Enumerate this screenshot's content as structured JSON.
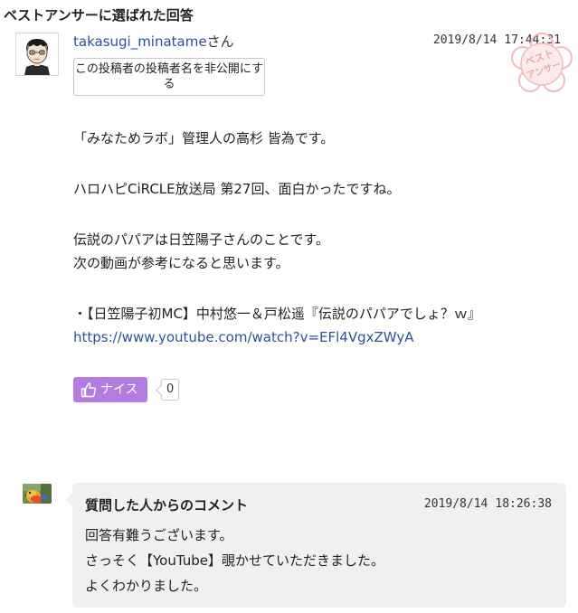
{
  "section_title": "ベストアンサーに選ばれた回答",
  "answer": {
    "author_name": "takasugi_minatame",
    "author_suffix": "さん",
    "date": "2019/8/14",
    "time": "17:44:31",
    "hide_name_button": "この投稿者の投稿者名を非公開にする",
    "best_answer_stamp": "ベスト アンサー",
    "body": {
      "line1": "「みなためラボ」管理人の高杉 皆為です。",
      "line2": "ハロハピCiRCLE放送局 第27回、面白かったですね。",
      "line3": "伝説のパパアは日笠陽子さんのことです。",
      "line4": "次の動画が参考になると思います。",
      "line5": "・【日笠陽子初MC】中村悠一＆戸松遥『伝説のパパアでしょ？ｗ』",
      "link": "https://www.youtube.com/watch?v=EFl4VgxZWyA"
    },
    "nice_label": "ナイス",
    "nice_count": "0"
  },
  "comment": {
    "title": "質問した人からのコメント",
    "date": "2019/8/14",
    "time": "18:26:38",
    "line1": "回答有難うございます。",
    "line2": "さっそく【YouTube】覗かせていただきました。",
    "line3": "よくわかりました。"
  },
  "colors": {
    "link": "#2e4f9c",
    "nice_button": "#b27ce1",
    "comment_background": "#f0f0f0",
    "stamp": "#f4c6c6"
  },
  "icons": {
    "answerer_avatar": "cartoon-boy-avatar",
    "commenter_avatar": "parrot-photo-avatar",
    "nice_button_icon": "thumbs-up-icon",
    "stamp": "best-answer-flower-stamp"
  }
}
